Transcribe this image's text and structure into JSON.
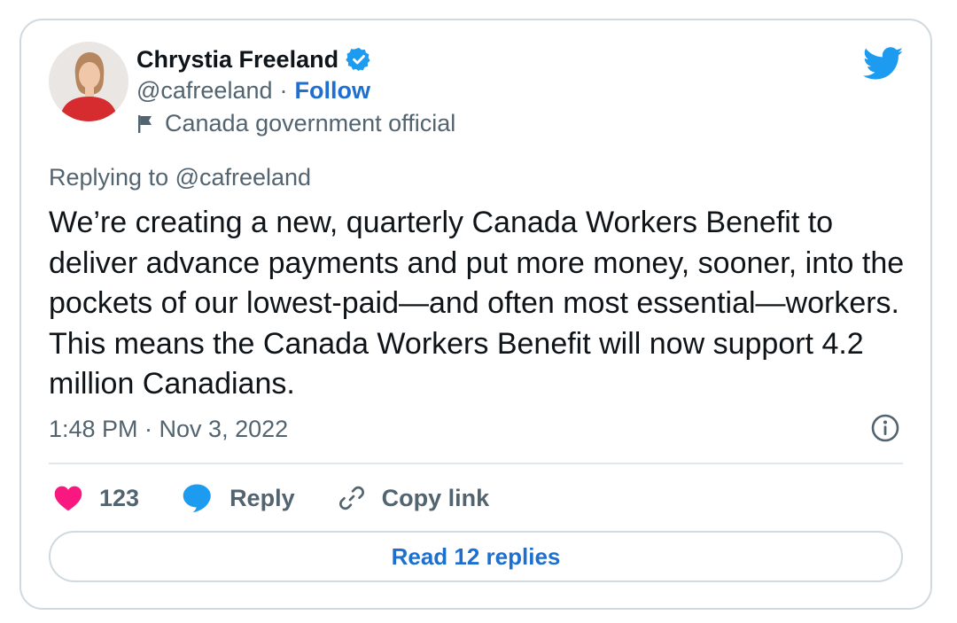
{
  "author": {
    "name": "Chrystia Freeland",
    "handle": "@cafreeland",
    "separator": "·",
    "follow_label": "Follow",
    "label": "Canada government official"
  },
  "tweet": {
    "replying_to": "Replying to @cafreeland",
    "text": "We’re creating a new, quarterly Canada Workers Benefit to deliver advance payments and put more money, sooner, into the pockets of our lowest-paid—and often most essential—workers. This means the Canada Workers Benefit will now support 4.2 million Canadians.",
    "timestamp": "1:48 PM · Nov 3, 2022"
  },
  "actions": {
    "like_count": "123",
    "reply_label": "Reply",
    "copy_link_label": "Copy link",
    "read_replies_label": "Read 12 replies"
  },
  "icons": {
    "verified": "verified-badge-icon",
    "flag": "flag-icon",
    "brand": "twitter-bird-icon",
    "info": "info-icon",
    "like": "heart-icon",
    "reply": "speech-bubble-icon",
    "copy_link": "link-icon"
  },
  "colors": {
    "accent": "#1d6fd0",
    "twitter_blue": "#1d9bf0",
    "like_pink": "#f91880",
    "muted_text": "#536471",
    "primary_text": "#0f1419",
    "border": "#cfd9de"
  }
}
